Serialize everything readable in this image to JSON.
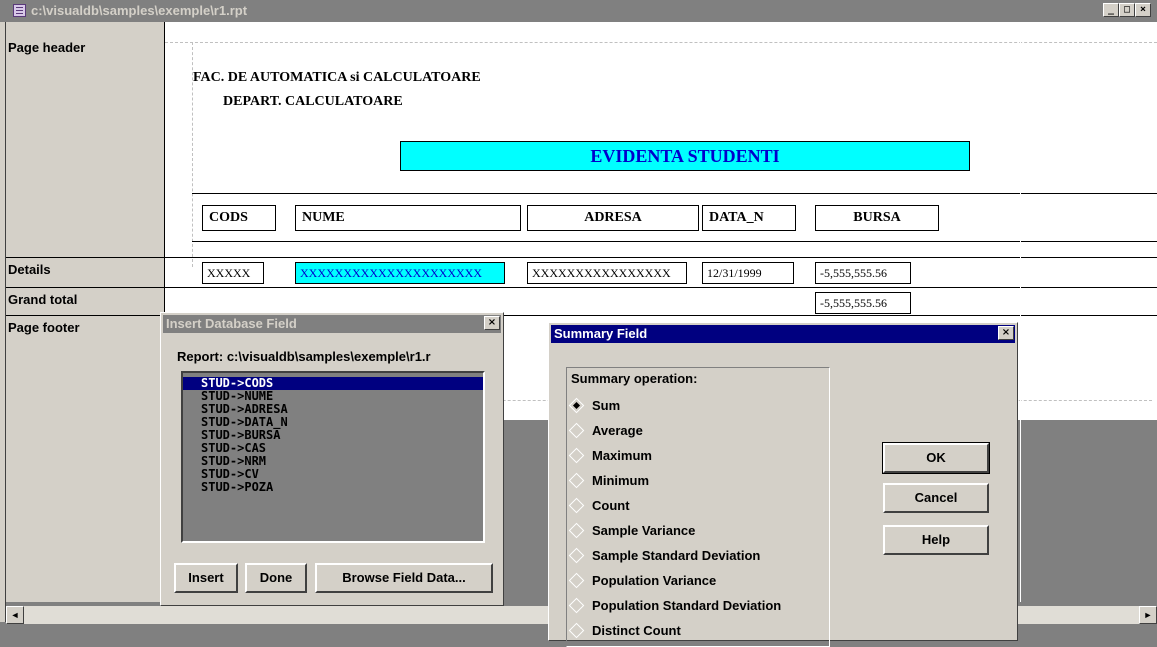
{
  "window": {
    "title": "c:\\visualdb\\samples\\exemple\\r1.rpt",
    "min": "_",
    "max": "□",
    "close": "×"
  },
  "sections": [
    "Page header",
    "Details",
    "Grand total",
    "Page footer"
  ],
  "report": {
    "header_line1": "FAC. DE AUTOMATICA si CALCULATOARE",
    "header_line2": "DEPART. CALCULATOARE",
    "title": "EVIDENTA STUDENTI",
    "columns": [
      "CODS",
      "NUME",
      "ADRESA",
      "DATA_N",
      "BURSA"
    ],
    "details": {
      "cods": "XXXXX",
      "nume": "XXXXXXXXXXXXXXXXXXXXX",
      "adresa": "XXXXXXXXXXXXXXXX",
      "data_n": "12/31/1999",
      "bursa": "-5,555,555.56"
    },
    "grand_total": "-5,555,555.56"
  },
  "insert_dialog": {
    "title": "Insert Database Field",
    "report_label": "Report: c:\\visualdb\\samples\\exemple\\r1.r",
    "fields": [
      "STUD->CODS",
      "STUD->NUME",
      "STUD->ADRESA",
      "STUD->DATA_N",
      "STUD->BURSA",
      "STUD->CAS",
      "STUD->NRM",
      "STUD->CV",
      "STUD->POZA"
    ],
    "selected_index": 0,
    "buttons": {
      "insert": "Insert",
      "done": "Done",
      "browse": "Browse Field Data..."
    },
    "close": "×"
  },
  "summary_dialog": {
    "title": "Summary Field",
    "group_label": "Summary operation:",
    "operations": [
      "Sum",
      "Average",
      "Maximum",
      "Minimum",
      "Count",
      "Sample Variance",
      "Sample Standard Deviation",
      "Population Variance",
      "Population Standard Deviation",
      "Distinct Count"
    ],
    "selected_index": 0,
    "buttons": {
      "ok": "OK",
      "cancel": "Cancel",
      "help": "Help"
    },
    "close": "×"
  },
  "scrollbar": {
    "left_arrow": "◄",
    "right_arrow": "►"
  }
}
